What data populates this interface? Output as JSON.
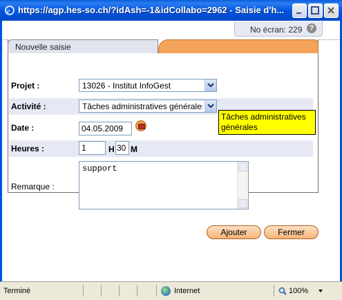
{
  "window": {
    "title": "https://agp.hes-so.ch/?idAsh=-1&idCollabo=2962 - Saisie d'h..."
  },
  "header": {
    "screen_label": "No écran: 229",
    "help_symbol": "?"
  },
  "tabs": {
    "active_label": "Nouvelle saisie"
  },
  "form": {
    "projet": {
      "label": "Projet :",
      "value": "13026 - Institut InfoGest"
    },
    "activite": {
      "label": "Activité :",
      "value": "Tâches administratives générales",
      "tooltip": "Tâches administratives générales"
    },
    "date": {
      "label": "Date :",
      "value": "04.05.2009"
    },
    "heures": {
      "label": "Heures :",
      "hours": "1",
      "hours_unit": "H",
      "minutes": "30",
      "minutes_unit": "M"
    },
    "remarque": {
      "label": "Remarque :",
      "value": "support"
    }
  },
  "buttons": {
    "add": "Ajouter",
    "close": "Fermer"
  },
  "statusbar": {
    "status": "Terminé",
    "zone": "Internet",
    "zoom": "100%"
  },
  "colors": {
    "accent_orange": "#f3a35a",
    "titlebar_blue": "#0053e1",
    "tooltip_yellow": "#ffff00"
  }
}
